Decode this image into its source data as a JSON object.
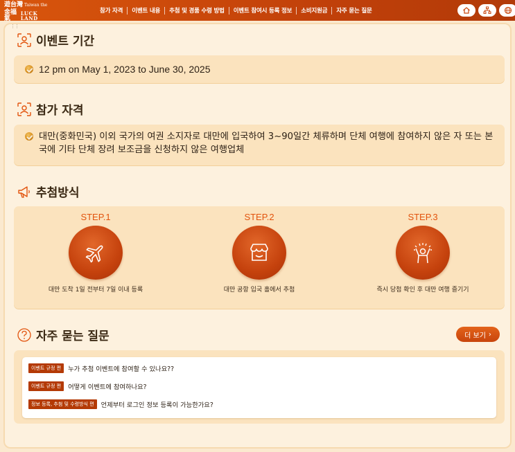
{
  "header": {
    "logo": {
      "line1": "遊台灣",
      "line1_small": "Taiwan the",
      "line2": "金福氣",
      "line2_small": "LUCK LAND"
    },
    "nav": [
      "참가 자격",
      "이벤트 내용",
      "추첨 및 경품 수령 방법",
      "이벤트 참여시 등록 정보",
      "소비지원금",
      "자주 묻는 질문"
    ],
    "buttons": [
      "home-icon",
      "sitemap-icon",
      "language-icon"
    ]
  },
  "period": {
    "title": "이벤트 기간",
    "text": "12 pm on May 1, 2023 to June 30, 2025"
  },
  "eligibility": {
    "title": "참가 자격",
    "text": "대만(중화민국) 이외 국가의 여권 소지자로 대만에 입국하여 3~90일간 체류하며 단체 여행에 참여하지 않은 자 또는 본국에 기타 단체 장려 보조금을 신청하지 않은 여행업체"
  },
  "draw": {
    "title": "추첨방식",
    "steps": [
      {
        "label": "STEP.1",
        "icon": "airplane-icon",
        "desc": "대만 도착 1일 전부터 7일 이내 등록"
      },
      {
        "label": "STEP.2",
        "icon": "shop-icon",
        "desc": "대만 공항 입국 홀에서 추첨"
      },
      {
        "label": "STEP.3",
        "icon": "celebrate-icon",
        "desc": "즉시 당첨 확인 후 대만 여행 즐기기"
      }
    ]
  },
  "faq": {
    "title": "자주 묻는 질문",
    "more": "더 보기",
    "items": [
      {
        "tag": "이벤트 규정 편",
        "q": "누가 추첨 이벤트에 참여할 수 있나요??"
      },
      {
        "tag": "이벤트 규정 편",
        "q": "어떻게 이벤트에 참여하나요?"
      },
      {
        "tag": "정보 등록, 추첨 및 수령방식 편",
        "q": "언제부터 로그인 정보 등록이 가능한가요?"
      }
    ]
  },
  "colors": {
    "header": "#c8450c",
    "accent": "#e2530d",
    "box": "#fbe3be",
    "background": "#fbe9cf"
  }
}
